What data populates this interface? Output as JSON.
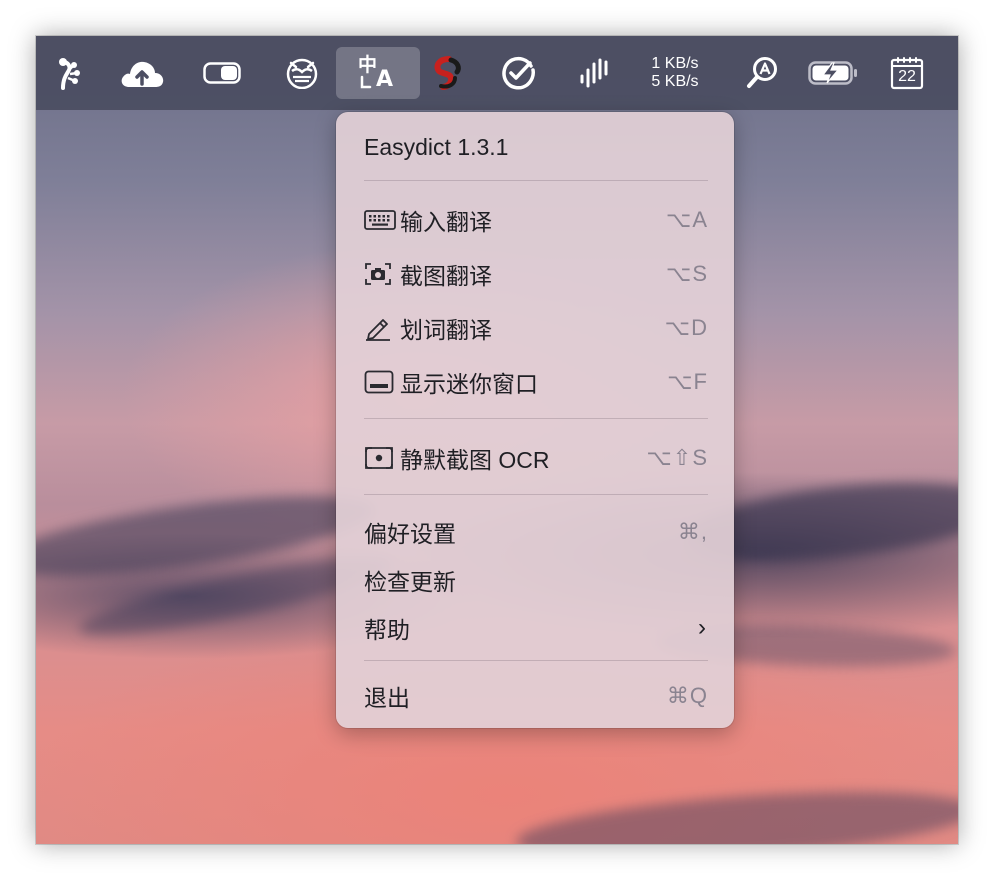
{
  "menubar": {
    "items": [
      {
        "name": "git-tree-icon"
      },
      {
        "name": "cloud-upload-icon"
      },
      {
        "name": "toggle-icon"
      },
      {
        "name": "owl-icon"
      },
      {
        "name": "translate-icon",
        "active": true
      },
      {
        "name": "yin-yang-icon"
      },
      {
        "name": "check-circle-icon"
      },
      {
        "name": "waveform-icon"
      },
      {
        "name": "network-speed"
      },
      {
        "name": "magnifier-a-icon"
      },
      {
        "name": "battery-charging-icon"
      },
      {
        "name": "calendar-icon"
      }
    ],
    "network": {
      "upload": "1 KB/s",
      "download": "5 KB/s"
    },
    "calendar_day": "22",
    "translate_glyph_top": "中",
    "translate_glyph_bottom": "A"
  },
  "menu": {
    "title": "Easydict  1.3.1",
    "items": [
      {
        "label": "输入翻译",
        "shortcut": "⌥A",
        "icon": "keyboard-icon"
      },
      {
        "label": "截图翻译",
        "shortcut": "⌥S",
        "icon": "screenshot-camera-icon"
      },
      {
        "label": "划词翻译",
        "shortcut": "⌥D",
        "icon": "pencil-icon"
      },
      {
        "label": "显示迷你窗口",
        "shortcut": "⌥F",
        "icon": "mini-window-icon"
      },
      {
        "label": "静默截图 OCR",
        "shortcut": "⌥⇧S",
        "icon": "silent-screenshot-icon"
      },
      {
        "label": "偏好设置",
        "shortcut": "⌘,"
      },
      {
        "label": "检查更新",
        "shortcut": ""
      },
      {
        "label": "帮助",
        "submenu_indicator": "›"
      },
      {
        "label": "退出",
        "shortcut": "⌘Q"
      }
    ]
  },
  "colors": {
    "menubar_bg": "#4c4e62",
    "menu_bg": "#e2d0d6",
    "shortcut_text": "#8a8390"
  }
}
